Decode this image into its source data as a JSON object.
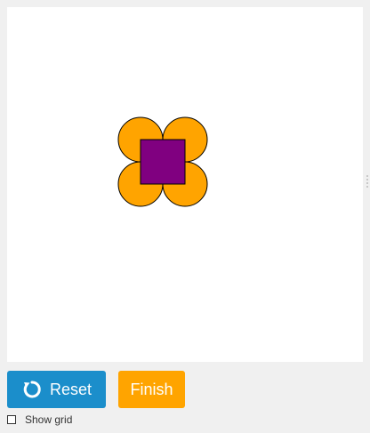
{
  "canvas": {
    "background": "#ffffff",
    "shapes": {
      "petal_color": "#ffa400",
      "square_color": "#800080",
      "stroke_color": "#000000"
    }
  },
  "toolbar": {
    "reset_label": "Reset",
    "reset_icon": "refresh-icon",
    "reset_color": "#1b8ecb",
    "finish_label": "Finish",
    "finish_color": "#ffa400"
  },
  "options": {
    "show_grid_label": "Show grid",
    "show_grid_checked": false
  }
}
